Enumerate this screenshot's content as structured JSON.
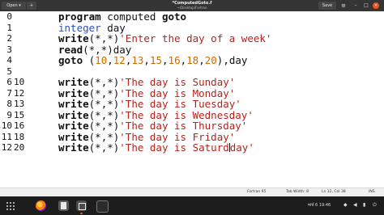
{
  "header": {
    "open_label": "Open",
    "title": "*ComputedGoto.f",
    "path": "~/Desktop/Fortran",
    "save_label": "Save"
  },
  "editor": {
    "line_numbers": [
      "0",
      "1",
      "2",
      "3",
      "4",
      "5",
      "6",
      "7",
      "8",
      "9",
      "10",
      "11",
      "12"
    ],
    "labels": [
      "",
      "",
      "",
      "",
      "",
      "",
      "10",
      "12",
      "13",
      "15",
      "16",
      "18",
      "20"
    ]
  },
  "code": {
    "l0_kw": "program",
    "l0_rest": " computed ",
    "l0_goto": "goto",
    "l1_type": "integer",
    "l1_rest": " day",
    "l2_kw": "write",
    "l2_mid": "(*,*)",
    "l2_str": "'Enter the day of a week'",
    "l3_kw": "read",
    "l3_rest": "(*,*)day",
    "l4_kw": "goto",
    "l4_open": " (",
    "l4_n1": "10",
    "l4_n2": "12",
    "l4_n3": "13",
    "l4_n4": "15",
    "l4_n5": "16",
    "l4_n6": "18",
    "l4_n7": "20",
    "l4_close": "),day",
    "comma": ",",
    "w_kw": "write",
    "w_mid": "(*,*)",
    "s6": "'The day is Sunday'",
    "s7": "'The day is Monday'",
    "s8": "'The day is Tuesday'",
    "s9": "'The day is Wednesday'",
    "s10": "'The day is Thursday'",
    "s11": "'The day is Friday'",
    "s12a": "'The day is Saturd",
    "s12b": "day'"
  },
  "statusbar": {
    "language": "Fortran 95",
    "tab_width": "Tab Width: 8",
    "position": "Ln 12, Col 38",
    "mode": "INS"
  },
  "dock": {
    "clock": "मार्च 6  19:46"
  }
}
